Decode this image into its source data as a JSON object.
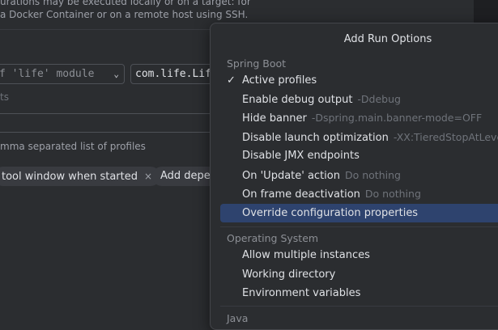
{
  "background": {
    "description_lines": [
      "urations may be executed locally or on a target: for",
      "a Docker Container or on a remote host using SSH."
    ],
    "module_combo": "f 'life' module",
    "main_class": "com.life.Life",
    "ghost_label": "ts",
    "profiles_hint": "mma separated list of profiles",
    "chips": [
      {
        "label": "tool window when started",
        "close": "×"
      },
      {
        "label": "Add depen",
        "close": ""
      }
    ]
  },
  "popup": {
    "title": "Add Run Options",
    "groups": [
      {
        "header": "Spring Boot",
        "items": [
          {
            "label": "Active profiles",
            "hint": "",
            "checked": true,
            "selected": false
          },
          {
            "label": "Enable debug output",
            "hint": "-Ddebug",
            "checked": false,
            "selected": false
          },
          {
            "label": "Hide banner",
            "hint": "-Dspring.main.banner-mode=OFF",
            "checked": false,
            "selected": false
          },
          {
            "label": "Disable launch optimization",
            "hint": "-XX:TieredStopAtLevel=",
            "checked": false,
            "selected": false
          },
          {
            "label": "Disable JMX endpoints",
            "hint": "",
            "checked": false,
            "selected": false
          },
          {
            "label": "On 'Update' action",
            "hint": "Do nothing",
            "checked": false,
            "selected": false
          },
          {
            "label": "On frame deactivation",
            "hint": "Do nothing",
            "checked": false,
            "selected": false
          },
          {
            "label": "Override configuration properties",
            "hint": "",
            "checked": false,
            "selected": true
          }
        ]
      },
      {
        "header": "Operating System",
        "items": [
          {
            "label": "Allow multiple instances",
            "hint": "",
            "checked": false,
            "selected": false
          },
          {
            "label": "Working directory",
            "hint": "",
            "checked": false,
            "selected": false
          },
          {
            "label": "Environment variables",
            "hint": "",
            "checked": false,
            "selected": false
          }
        ]
      },
      {
        "header": "Java",
        "items": []
      }
    ],
    "check_glyph": "✓",
    "colors": {
      "selection": "#2e436e",
      "hint": "#6f737a",
      "text": "#dfe1e5"
    }
  },
  "icons": {
    "chevron": "chevron-down-icon",
    "check": "check-icon",
    "close": "close-icon"
  }
}
